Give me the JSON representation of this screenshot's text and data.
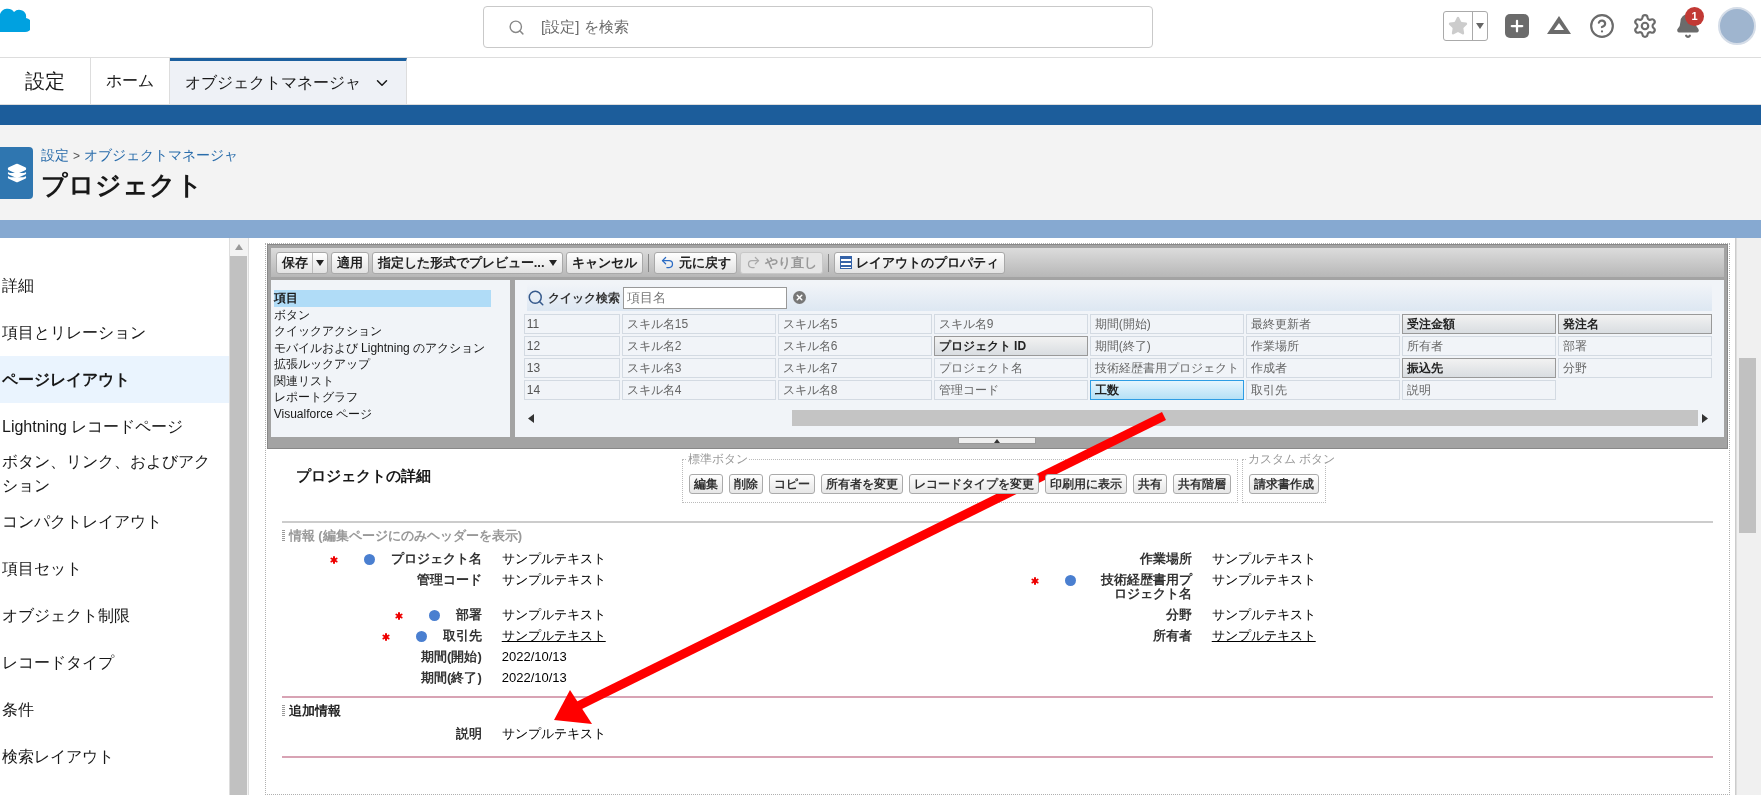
{
  "header": {
    "search_placeholder": "[設定] を検索",
    "notification_count": "1"
  },
  "nav": {
    "app_name": "設定",
    "tabs": [
      {
        "label": "ホーム",
        "selected": false,
        "menu": false
      },
      {
        "label": "オブジェクトマネージャ",
        "selected": true,
        "menu": true
      }
    ]
  },
  "page_header": {
    "breadcrumb": [
      {
        "label": "設定"
      },
      {
        "label": "オブジェクトマネージャ"
      }
    ],
    "separator": ">",
    "title": "プロジェクト"
  },
  "sidebar": {
    "items": [
      {
        "label": "詳細",
        "selected": false
      },
      {
        "label": "項目とリレーション",
        "selected": false
      },
      {
        "label": "ページレイアウト",
        "selected": true
      },
      {
        "label": "Lightning レコードページ",
        "selected": false
      },
      {
        "label": "ボタン、リンク、およびアクション",
        "selected": false
      },
      {
        "label": "コンパクトレイアウト",
        "selected": false
      },
      {
        "label": "項目セット",
        "selected": false
      },
      {
        "label": "オブジェクト制限",
        "selected": false
      },
      {
        "label": "レコードタイプ",
        "selected": false
      },
      {
        "label": "条件",
        "selected": false
      },
      {
        "label": "検索レイアウト",
        "selected": false
      }
    ]
  },
  "toolbar": [
    {
      "label": "保存",
      "kind": "split",
      "disabled": false
    },
    {
      "label": "適用",
      "kind": "plain",
      "disabled": false
    },
    {
      "label": "指定した形式でプレビュー...",
      "kind": "dropdown",
      "disabled": false
    },
    {
      "label": "キャンセル",
      "kind": "plain",
      "disabled": false
    },
    {
      "label": "元に戻す",
      "kind": "undo",
      "disabled": false
    },
    {
      "label": "やり直し",
      "kind": "redo",
      "disabled": true
    },
    {
      "label": "レイアウトのプロパティ",
      "kind": "properties",
      "disabled": false
    }
  ],
  "palette": {
    "categories": [
      {
        "label": "項目",
        "selected": true
      },
      {
        "label": "ボタン",
        "selected": false
      },
      {
        "label": "クイックアクション",
        "selected": false
      },
      {
        "label": "モバイルおよび Lightning のアクション",
        "selected": false
      },
      {
        "label": "拡張ルックアップ",
        "selected": false
      },
      {
        "label": "関連リスト",
        "selected": false
      },
      {
        "label": "レポートグラフ",
        "selected": false
      },
      {
        "label": "Visualforce ページ",
        "selected": false
      }
    ],
    "quick_search_label": "クイック検索",
    "quick_search_placeholder": "項目名",
    "rows": [
      {
        "number": "11",
        "cells": [
          {
            "label": "スキル名15",
            "placed": true,
            "selected": false
          },
          {
            "label": "スキル名5",
            "placed": true,
            "selected": false
          },
          {
            "label": "スキル名9",
            "placed": true,
            "selected": false
          },
          {
            "label": "期間(開始)",
            "placed": true,
            "selected": false
          },
          {
            "label": "最終更新者",
            "placed": true,
            "selected": false
          },
          {
            "label": "受注金額",
            "placed": false,
            "selected": false
          },
          {
            "label": "発注名",
            "placed": false,
            "selected": false
          }
        ]
      },
      {
        "number": "12",
        "cells": [
          {
            "label": "スキル名2",
            "placed": true,
            "selected": false
          },
          {
            "label": "スキル名6",
            "placed": true,
            "selected": false
          },
          {
            "label": "プロジェクト ID",
            "placed": false,
            "selected": false
          },
          {
            "label": "期間(終了)",
            "placed": true,
            "selected": false
          },
          {
            "label": "作業場所",
            "placed": true,
            "selected": false
          },
          {
            "label": "所有者",
            "placed": true,
            "selected": false
          },
          {
            "label": "部署",
            "placed": true,
            "selected": false
          }
        ]
      },
      {
        "number": "13",
        "cells": [
          {
            "label": "スキル名3",
            "placed": true,
            "selected": false
          },
          {
            "label": "スキル名7",
            "placed": true,
            "selected": false
          },
          {
            "label": "プロジェクト名",
            "placed": true,
            "selected": false
          },
          {
            "label": "技術経歴書用プロジェクト",
            "placed": true,
            "selected": false
          },
          {
            "label": "作成者",
            "placed": true,
            "selected": false
          },
          {
            "label": "振込先",
            "placed": false,
            "selected": false
          },
          {
            "label": "分野",
            "placed": true,
            "selected": false
          }
        ]
      },
      {
        "number": "14",
        "cells": [
          {
            "label": "スキル名4",
            "placed": true,
            "selected": false
          },
          {
            "label": "スキル名8",
            "placed": true,
            "selected": false
          },
          {
            "label": "管理コード",
            "placed": true,
            "selected": false
          },
          {
            "label": "工数",
            "placed": false,
            "selected": true
          },
          {
            "label": "取引先",
            "placed": true,
            "selected": false
          },
          {
            "label": "説明",
            "placed": true,
            "selected": false
          }
        ]
      }
    ]
  },
  "detail": {
    "title": "プロジェクトの詳細",
    "button_groups": [
      {
        "legend": "標準ボタン",
        "buttons": [
          "編集",
          "削除",
          "コピー",
          "所有者を変更",
          "レコードタイプを変更",
          "印刷用に表示",
          "共有",
          "共有階層"
        ]
      },
      {
        "legend": "カスタム ボタン",
        "buttons": [
          "請求書作成"
        ]
      }
    ],
    "sections": [
      {
        "title": "情報 (編集ページにのみヘッダーを表示)",
        "header_visible": false,
        "rows": [
          [
            {
              "label": "プロジェクト名",
              "value": "サンプルテキスト",
              "required": true,
              "dot": true,
              "link": false
            },
            {
              "label": "作業場所",
              "value": "サンプルテキスト",
              "required": false,
              "dot": false,
              "link": false
            }
          ],
          [
            {
              "label": "管理コード",
              "value": "サンプルテキスト",
              "required": false,
              "dot": false,
              "link": false
            },
            {
              "label": "技術経歴書用プロジェクト名",
              "value": "サンプルテキスト",
              "required": true,
              "dot": true,
              "link": false
            }
          ],
          [
            {
              "label": "部署",
              "value": "サンプルテキスト",
              "required": true,
              "dot": true,
              "link": false
            },
            {
              "label": "分野",
              "value": "サンプルテキスト",
              "required": false,
              "dot": false,
              "link": false
            }
          ],
          [
            {
              "label": "取引先",
              "value": "サンプルテキスト",
              "required": true,
              "dot": true,
              "link": true
            },
            {
              "label": "所有者",
              "value": "サンプルテキスト",
              "required": false,
              "dot": false,
              "link": true
            }
          ],
          [
            {
              "label": "期間(開始)",
              "value": "2022/10/13",
              "required": false,
              "dot": false,
              "link": false
            }
          ],
          [
            {
              "label": "期間(終了)",
              "value": "2022/10/13",
              "required": false,
              "dot": false,
              "link": false
            }
          ]
        ]
      },
      {
        "title": "追加情報",
        "header_visible": true,
        "rows": [
          [
            {
              "label": "説明",
              "value": "サンプルテキスト",
              "required": false,
              "dot": false,
              "link": false
            }
          ]
        ]
      }
    ]
  }
}
